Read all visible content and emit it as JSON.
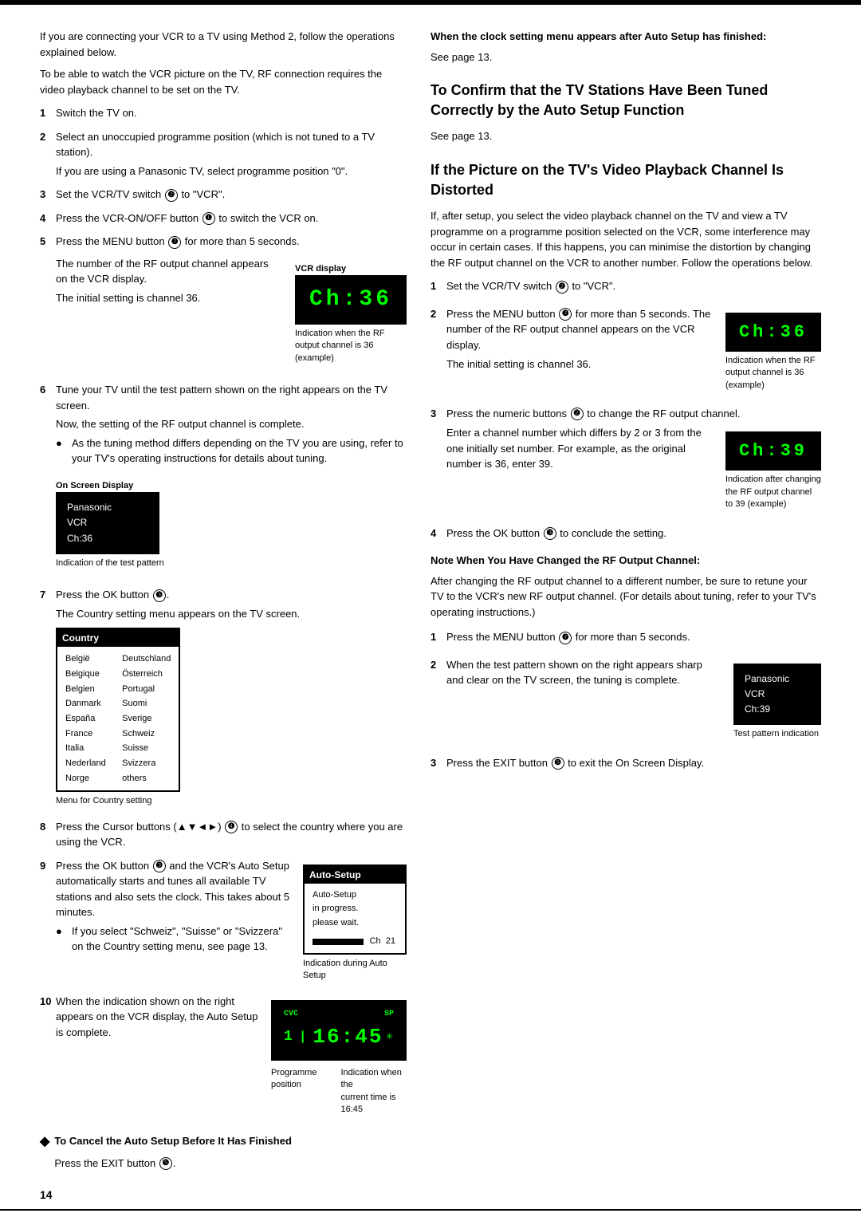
{
  "page": {
    "number": "14",
    "top_rule": true
  },
  "left": {
    "intro": [
      "If you are connecting your VCR to a TV using Method 2, follow the operations explained below.",
      "To be able to watch the VCR picture on the TV, RF connection requires the video playback channel to be set on the TV."
    ],
    "steps": [
      {
        "num": "1",
        "text": "Switch the TV on."
      },
      {
        "num": "2",
        "text": "Select an unoccupied programme position (which is not tuned to a TV station).",
        "extra": "If you are using a Panasonic TV, select programme position \"0\"."
      },
      {
        "num": "3",
        "text": "Set the VCR/TV switch ❷ to \"VCR\"."
      },
      {
        "num": "4",
        "text": "Press the VCR-ON/OFF button ❶ to switch the VCR on."
      },
      {
        "num": "5",
        "text": "Press the MENU button ❼ for more than 5 seconds.",
        "extra1": "The number of the RF output channel appears on the VCR display.",
        "extra2": "The initial setting is channel 36.",
        "display_label": "VCR display",
        "display_value": "Ch:36",
        "display_caption": "Indication when the RF output channel is 36 (example)"
      },
      {
        "num": "6",
        "text": "Tune your TV until the test pattern shown on the right appears on the TV screen.",
        "extra": "Now, the setting of the RF output channel is complete.",
        "bullet": "As the tuning method differs depending on the TV you are using, refer to your TV's operating instructions for details about tuning.",
        "onscreen_label": "On Screen Display",
        "onscreen_panasonic": "Panasonic",
        "onscreen_vcr": "VCR",
        "onscreen_ch": "Ch:36",
        "pattern_caption": "Indication of the test pattern"
      },
      {
        "num": "7",
        "text": "Press the OK button ❸.",
        "extra": "The Country setting menu appears on the TV screen.",
        "country_header": "Country",
        "country_left": [
          "België",
          "Belgique",
          "Belgien",
          "Danmark",
          "España",
          "France",
          "Italia",
          "Nederland",
          "Norge"
        ],
        "country_right": [
          "Deutschland",
          "Österreich",
          "Portugal",
          "Suomi",
          "Sverige",
          "Schweiz",
          "Suisse",
          "Svizzera",
          "others"
        ],
        "country_caption": "Menu for Country setting"
      },
      {
        "num": "8",
        "text": "Press the Cursor buttons (▲▼◄►) ❹ to select the country where you are using the VCR."
      },
      {
        "num": "9",
        "text": "Press the OK button ❸ and the VCR's Auto Setup automatically starts and tunes all available TV stations and also sets the clock. This takes about 5 minutes.",
        "bullet": "If you select \"Schweiz\", \"Suisse\" or \"Svizzera\" on the Country setting menu, see page 13.",
        "autosetup_header": "Auto-Setup",
        "autosetup_item1": "Auto-Setup",
        "autosetup_item2": "in progress.",
        "autosetup_item3": "please wait.",
        "autosetup_ch": "Ch",
        "autosetup_num": "21",
        "autosetup_caption": "Indication during Auto Setup"
      },
      {
        "num": "10",
        "text": "When the indication shown on the right appears on the VCR display, the Auto Setup is complete.",
        "cvc": "CVC",
        "sp": "SP",
        "prog": "1",
        "time": "16:45",
        "asterisk": "*",
        "prog_label": "Programme position",
        "time_label": "Indication when the current time is 16:45"
      }
    ],
    "cancel": {
      "label": "To Cancel the Auto Setup Before It Has Finished",
      "text": "Press the EXIT button ❺."
    }
  },
  "right": {
    "clock_heading": "When the clock setting menu appears after Auto Setup has finished:",
    "clock_text": "See page 13.",
    "confirm_heading": "To Confirm that the TV Stations Have Been Tuned Correctly by the Auto Setup Function",
    "confirm_text": "See page 13.",
    "distorted_heading": "If the Picture on the TV's Video Playback Channel Is Distorted",
    "distorted_intro": "If, after setup, you select the video playback channel on the TV and view a TV programme on a programme position selected on the VCR, some interference may occur in certain cases. If this happens, you can minimise the distortion by changing the RF output channel on the VCR to another number. Follow the operations below.",
    "steps": [
      {
        "num": "1",
        "text": "Set the VCR/TV switch ❷ to \"VCR\"."
      },
      {
        "num": "2",
        "text": "Press the MENU button ❼ for more than 5 seconds. The number of the RF output channel appears on the VCR display.",
        "extra": "The initial setting is channel 36.",
        "display_value": "Ch:36",
        "display_caption": "Indication when the RF output channel is 36 (example)"
      },
      {
        "num": "3",
        "text": "Press the numeric buttons ❷ to change the RF output channel.",
        "extra1": "Enter a channel number which differs by 2 or 3 from the one initially set number. For example, as the original number is 36, enter 39.",
        "display_value": "Ch:39",
        "display_caption": "Indication after changing the RF output channel to 39 (example)"
      },
      {
        "num": "4",
        "text": "Press the OK button ❸ to conclude the setting."
      }
    ],
    "note_heading": "Note When You Have Changed the RF Output Channel:",
    "note_text": "After changing the RF output channel to a different number, be sure to retune your TV to the VCR's new RF output channel. (For details about tuning, refer to your TV's operating instructions.)",
    "final_steps": [
      {
        "num": "1",
        "text": "Press the MENU button ❼ for more than 5 seconds."
      },
      {
        "num": "2",
        "text": "When the test pattern shown on the right appears sharp and clear on the TV screen, the tuning is complete.",
        "onscreen_panasonic": "Panasonic",
        "onscreen_vcr": "VCR",
        "onscreen_ch": "Ch:39",
        "pattern_caption": "Test pattern indication"
      },
      {
        "num": "3",
        "text": "Press the EXIT button ❺ to exit the On Screen Display."
      }
    ]
  }
}
